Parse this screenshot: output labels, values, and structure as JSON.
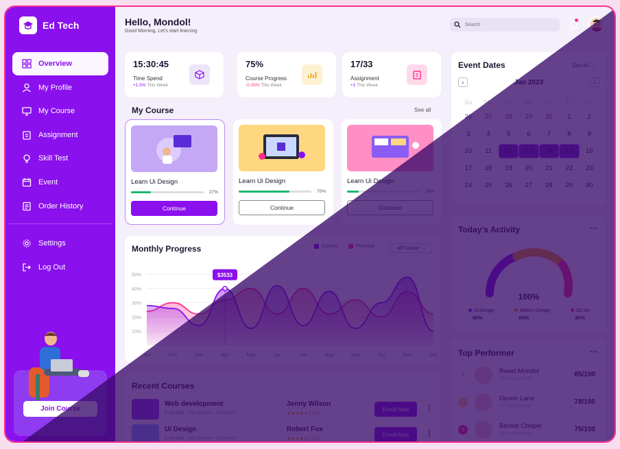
{
  "brand": {
    "name": "Ed Tech"
  },
  "nav": [
    {
      "label": "Overview",
      "icon": "grid-icon"
    },
    {
      "label": "My Profile",
      "icon": "user-icon"
    },
    {
      "label": "My Course",
      "icon": "monitor-icon"
    },
    {
      "label": "Assignment",
      "icon": "clipboard-icon"
    },
    {
      "label": "Skill Test",
      "icon": "bulb-icon"
    },
    {
      "label": "Event",
      "icon": "calendar-icon"
    },
    {
      "label": "Order History",
      "icon": "receipt-icon"
    }
  ],
  "nav2": [
    {
      "label": "Settings",
      "icon": "gear-icon"
    },
    {
      "label": "Log Out",
      "icon": "logout-icon"
    }
  ],
  "promo": {
    "button": "Join Course"
  },
  "header": {
    "greeting": "Hello, Mondol!",
    "subtitle": "Good Morning, Let's start learning",
    "search_placeholder": "Search"
  },
  "stats": [
    {
      "value": "15:30:45",
      "label": "Time Spend",
      "change": "+1.5%",
      "period": "This Week",
      "icon": "cube-icon"
    },
    {
      "value": "75%",
      "label": "Course Progress",
      "change": "-0.35%",
      "period": "This Week",
      "icon": "bar-chart-icon"
    },
    {
      "value": "17/33",
      "label": "Assignment",
      "change": "+1",
      "period": "This Week",
      "icon": "clipboard-icon"
    }
  ],
  "my_course": {
    "title": "My Course",
    "see_all": "See all",
    "items": [
      {
        "title": "Learn Ui Design",
        "progress": 27,
        "progress_label": "27%",
        "button": "Continue"
      },
      {
        "title": "Learn Ui Design",
        "progress": 70,
        "progress_label": "70%",
        "button": "Continue"
      },
      {
        "title": "Learn Ui Design",
        "progress": 16,
        "progress_label": "16%",
        "button": "Continue"
      }
    ]
  },
  "monthly": {
    "title": "Monthly Progress",
    "legend_current": "Current",
    "legend_previous": "Previous",
    "filter": "All Course",
    "tooltip": "$3533",
    "colors": {
      "current": "#8a10ee",
      "previous": "#ff2f8e"
    }
  },
  "chart_data": {
    "type": "area",
    "categories": [
      "Jan",
      "Feb",
      "Mar",
      "Apr",
      "May",
      "Jun",
      "Jul",
      "Aug",
      "Sep",
      "Oct",
      "Nov",
      "Dec"
    ],
    "y_ticks": [
      "50%",
      "40%",
      "30%",
      "20%",
      "10%"
    ],
    "ylim": [
      0,
      50
    ],
    "series": [
      {
        "name": "Current",
        "values": [
          28,
          26,
          14,
          40,
          12,
          42,
          14,
          38,
          12,
          30,
          48,
          10
        ]
      },
      {
        "name": "Previous",
        "values": [
          24,
          30,
          22,
          32,
          40,
          22,
          40,
          22,
          32,
          20,
          38,
          22
        ]
      }
    ]
  },
  "recent": {
    "title": "Recent Courses",
    "items": [
      {
        "name": "Web development",
        "sub": "5 Module - 32 Lession - 16 Hours",
        "author": "Jenny Wilson",
        "stars": "★★★★★",
        "reviews": "(150)",
        "button": "Enroll Now"
      },
      {
        "name": "Ui Design",
        "sub": "6 Module - 28 Lession - 15 Hours",
        "author": "Robert Fox",
        "stars": "★★★★★",
        "reviews": "(105)",
        "button": "Enroll Now"
      }
    ]
  },
  "events": {
    "title": "Event Dates",
    "see_all": "See all →",
    "month": "Jan 2023",
    "dow": [
      "Su",
      "Mo",
      "Tu",
      "We",
      "Th",
      "Fr",
      "Sa"
    ],
    "days": [
      "26",
      "27",
      "28",
      "29",
      "30",
      "1",
      "2",
      "3",
      "4",
      "5",
      "6",
      "7",
      "8",
      "9",
      "10",
      "11",
      "12",
      "13",
      "14",
      "15",
      "16",
      "17",
      "18",
      "19",
      "20",
      "21",
      "22",
      "23",
      "24",
      "25",
      "26",
      "27",
      "28",
      "29",
      "30"
    ],
    "muted_count": 5,
    "selected": [
      "12",
      "13",
      "14",
      "15"
    ]
  },
  "activity": {
    "title": "Today's Activity",
    "center": "100%",
    "items": [
      {
        "label": "Ui Design",
        "value": "40%",
        "color": "#8a10ee"
      },
      {
        "label": "Motion Design",
        "value": "65%",
        "color": "#f7a600"
      },
      {
        "label": "3D Art",
        "value": "30%",
        "color": "#ff2f8e"
      }
    ]
  },
  "performer": {
    "title": "Top Performer",
    "items": [
      {
        "rank": "1",
        "name": "Rasel Mondol",
        "sub": "15 Assignment",
        "score": "85/100"
      },
      {
        "rank": "2",
        "name": "Devon Lane",
        "sub": "17 Assignment",
        "score": "78/100"
      },
      {
        "rank": "3",
        "name": "Bessie Cooper",
        "sub": "20 Assignment",
        "score": "75/100"
      }
    ]
  }
}
